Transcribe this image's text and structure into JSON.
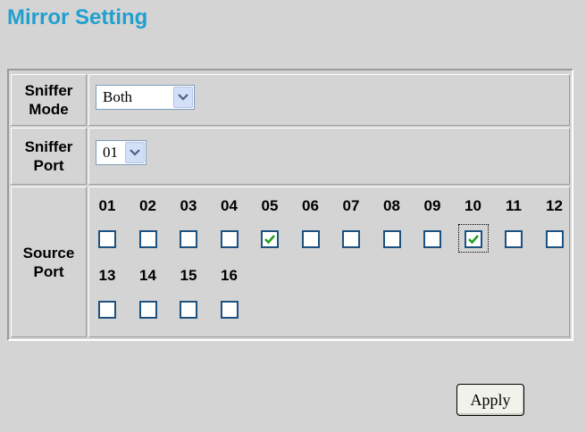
{
  "page": {
    "title": "Mirror Setting"
  },
  "sniffer_mode": {
    "label": "Sniffer Mode",
    "value": "Both",
    "options": [
      "Both"
    ]
  },
  "sniffer_port": {
    "label": "Sniffer Port",
    "value": "01"
  },
  "source_port": {
    "label": "Source Port",
    "ports": [
      {
        "number": "01",
        "checked": false
      },
      {
        "number": "02",
        "checked": false
      },
      {
        "number": "03",
        "checked": false
      },
      {
        "number": "04",
        "checked": false
      },
      {
        "number": "05",
        "checked": true
      },
      {
        "number": "06",
        "checked": false
      },
      {
        "number": "07",
        "checked": false
      },
      {
        "number": "08",
        "checked": false
      },
      {
        "number": "09",
        "checked": false
      },
      {
        "number": "10",
        "checked": true,
        "focused": true
      },
      {
        "number": "11",
        "checked": false
      },
      {
        "number": "12",
        "checked": false
      },
      {
        "number": "13",
        "checked": false
      },
      {
        "number": "14",
        "checked": false
      },
      {
        "number": "15",
        "checked": false
      },
      {
        "number": "16",
        "checked": false
      }
    ]
  },
  "apply_button": {
    "label": "Apply"
  },
  "colors": {
    "title": "#1fa0cf",
    "check": "#21a121",
    "background": "#d4d4d4"
  }
}
